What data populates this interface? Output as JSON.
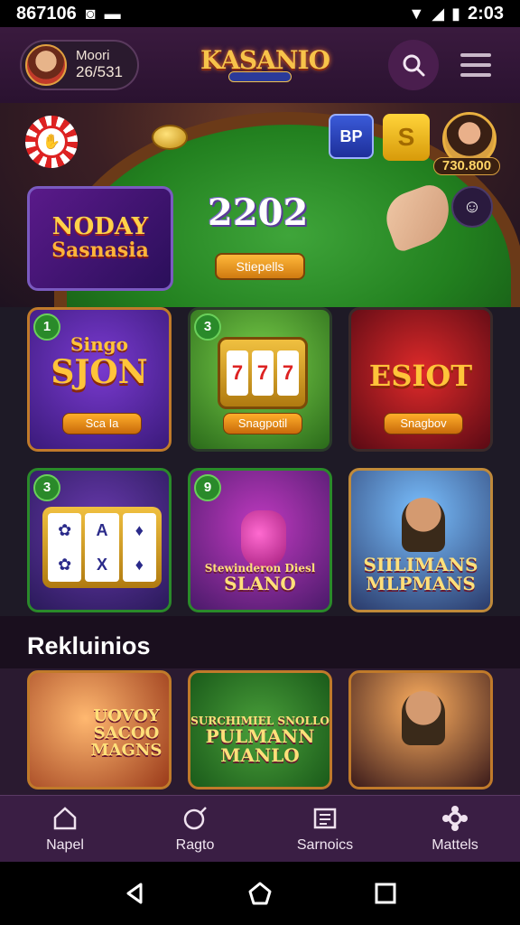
{
  "status_bar": {
    "time_left": "867106",
    "time_right": "2:03"
  },
  "header": {
    "profile_name": "Moori",
    "profile_balance": "26/531",
    "logo_text": "KASANIO"
  },
  "hero": {
    "coin_badge_label": "BP",
    "s_badge_label": "S",
    "dealer_amount": "730.800",
    "promo_title": "NODAY",
    "promo_subtitle": "Sasnasia",
    "year_text": "2202",
    "hero_button_label": "Stiepells"
  },
  "games": [
    {
      "number": "1",
      "title": "SJON",
      "subtitle": "Singo",
      "button": "Sca Ia"
    },
    {
      "number": "3",
      "title": "7",
      "button": "Snagpotil"
    },
    {
      "title": "ESIOT",
      "button": "Snagbov"
    },
    {
      "number": "3",
      "reels": [
        "A",
        "X"
      ]
    },
    {
      "number": "9",
      "caption_small": "Stewinderon Diesl",
      "caption": "SLANO"
    },
    {
      "caption": "SIILIMANS MLPMANS"
    }
  ],
  "section_title": "Rekluinios",
  "bottom_games": [
    {
      "caption": "UOVOY SACOO MAGNS"
    },
    {
      "caption_small": "SURCHIMIEL SNOLLO",
      "caption": "PULMANN MANLO"
    },
    {
      "caption": ""
    }
  ],
  "bottom_nav": [
    {
      "label": "Napel",
      "icon": "home-icon"
    },
    {
      "label": "Ragto",
      "icon": "sparkle-icon"
    },
    {
      "label": "Sarnoics",
      "icon": "document-icon"
    },
    {
      "label": "Mattels",
      "icon": "settings-icon"
    }
  ]
}
